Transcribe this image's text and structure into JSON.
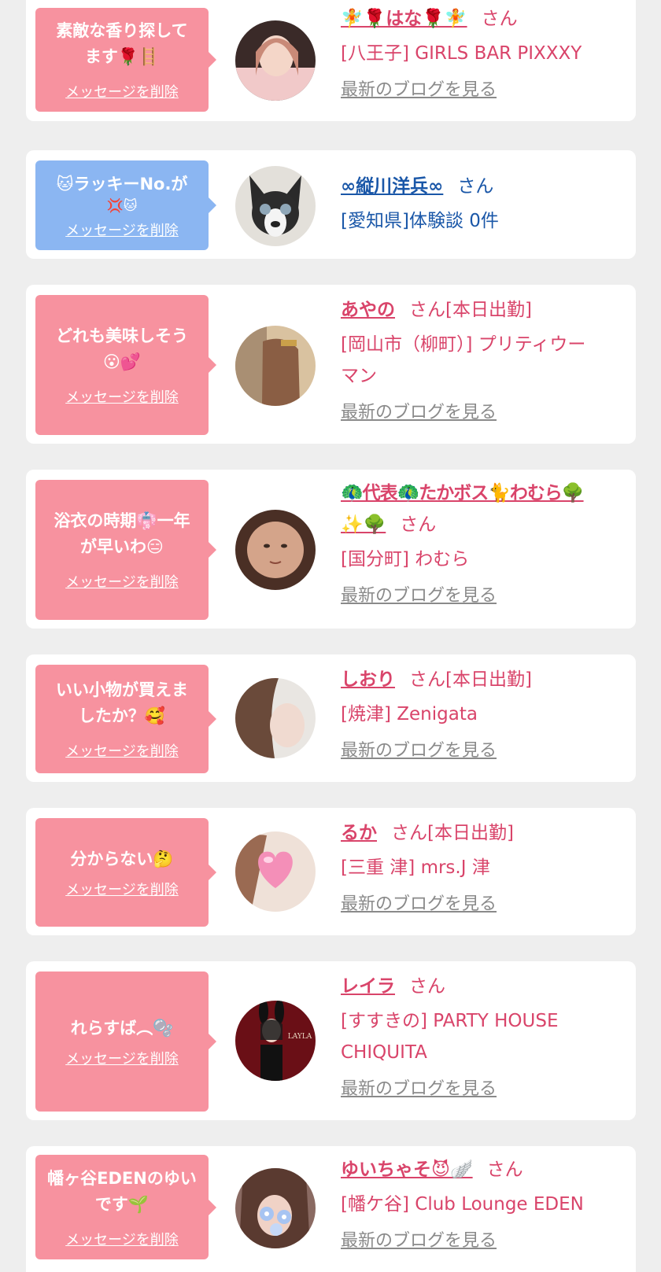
{
  "common": {
    "delete_label": "メッセージを削除",
    "blog_label": "最新のブログを見る",
    "san": "さん",
    "today": "[本日出勤]"
  },
  "colors": {
    "pink_bubble": "#f7929f",
    "blue_bubble": "#8bb6f2",
    "pink_text": "#d9446a",
    "blue_text": "#1a57a8",
    "gray_link": "#8a8a8a"
  },
  "cards": [
    {
      "message_l1": "素敵な香り探して",
      "message_l2": "ます🌹🪜",
      "name": "🧚🌹はな🌹🧚",
      "shop": "[八王子] GIRLS BAR PIXXXY",
      "today": "",
      "avatar": "avatar-woman-pink-sweater"
    },
    {
      "message_l1": "🐱ラッキーNo.が",
      "message_l2": "💢🐱",
      "name": "∞縦川洋兵∞",
      "shop": "[愛知県]体験談 0件",
      "today": "",
      "avatar": "avatar-boston-terrier"
    },
    {
      "message_l1": "どれも美味しそう",
      "message_l2": "😮💕",
      "name": "あやの",
      "shop_l1": "[岡山市（柳町）] プリティウー",
      "shop_l2": "マン",
      "today": "[本日出勤]",
      "avatar": "avatar-hair-back"
    },
    {
      "message_l1": "浴衣の時期👘一年",
      "message_l2": "が早いわ😑",
      "name_l1": "🦚代表🦚たかボス🐈わむら🌳",
      "name_l2": "✨🌳",
      "shop": "[国分町] わむら",
      "today": "",
      "avatar": "avatar-face-doll"
    },
    {
      "message_l1": "いい小物が買えま",
      "message_l2": "したか？🥰",
      "name": "しおり",
      "shop": "[焼津] Zenigata",
      "today": "[本日出勤]",
      "avatar": "avatar-woman-light"
    },
    {
      "message_l1": "分からない🤔",
      "name": "るか",
      "shop": "[三重 津] mrs.J 津",
      "today": "[本日出勤]",
      "avatar": "avatar-heart-face"
    },
    {
      "message_l1": "れらすば︵🫧",
      "name": "レイラ",
      "shop_l1": "[すすきの] PARTY HOUSE",
      "shop_l2": "CHIQUITA",
      "today": "",
      "avatar": "avatar-bunny-layla",
      "avatar_text": "LAYLA"
    },
    {
      "message_l1": "幡ヶ谷EDENのゆい",
      "message_l2": "です🌱",
      "name": "ゆいちゃそ😈🪽",
      "shop": "[幡ケ谷] Club Lounge EDEN",
      "today": "",
      "avatar": "avatar-flowers-face"
    }
  ]
}
